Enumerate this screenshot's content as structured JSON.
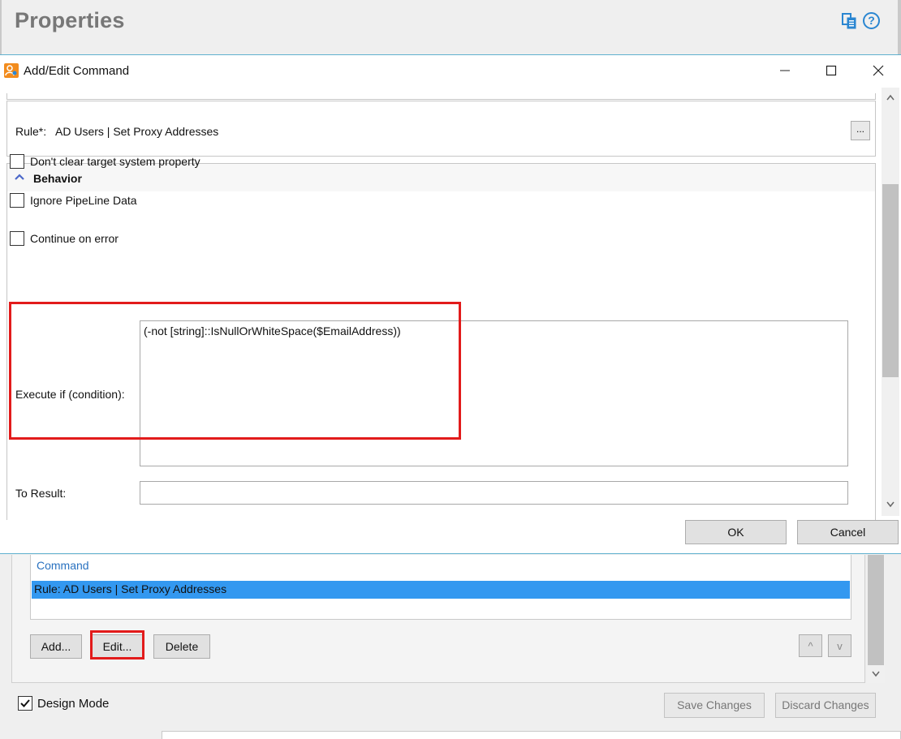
{
  "properties": {
    "title": "Properties"
  },
  "dialog": {
    "title": "Add/Edit Command",
    "rule": {
      "label": "Rule*:",
      "value": "AD Users | Set Proxy Addresses",
      "browse_label": "..."
    },
    "behavior": {
      "title": "Behavior",
      "checkboxes": [
        {
          "label": "Don't clear target system property",
          "checked": false
        },
        {
          "label": "Ignore PipeLine Data",
          "checked": false
        },
        {
          "label": "Continue on error",
          "checked": false
        }
      ],
      "condition_label": "Execute if (condition):",
      "condition_value": "(-not [string]::IsNullOrWhiteSpace($EmailAddress))",
      "result_label": "To Result:",
      "result_value": ""
    },
    "ok_label": "OK",
    "cancel_label": "Cancel"
  },
  "commands": {
    "header": "Command",
    "rows": [
      {
        "text": "Rule: AD Users | Set Proxy Addresses",
        "selected": true
      }
    ],
    "add_label": "Add...",
    "edit_label": "Edit...",
    "delete_label": "Delete",
    "up_label": "^",
    "down_label": "v"
  },
  "footer": {
    "design_mode_label": "Design Mode",
    "design_mode_checked": true,
    "save_label": "Save Changes",
    "discard_label": "Discard Changes"
  },
  "colors": {
    "highlight_red": "#e21b1b",
    "selection_blue": "#3398f0",
    "accent_blue": "#2a86d1"
  },
  "icons": {
    "copy": "copy-icon",
    "help": "help-icon",
    "app": "app-icon",
    "minimize": "minimize-icon",
    "maximize": "maximize-icon",
    "close": "close-icon",
    "collapse": "chevron-up-icon"
  }
}
